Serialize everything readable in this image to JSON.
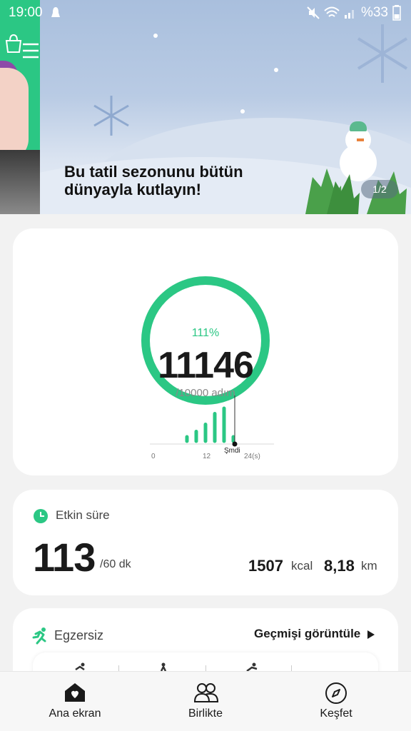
{
  "status_bar": {
    "time": "19:00",
    "battery": "%33"
  },
  "banner": {
    "headline_line1": "Bu tatil sezonunu bütün",
    "headline_line2": "dünyayla kutlayın!",
    "page_indicator": "1/2"
  },
  "steps": {
    "percent": "111%",
    "count": "11146",
    "goal": "/10000 adım",
    "progress_fraction": 1.0,
    "chart": {
      "type": "bar",
      "x_ticks": [
        "0",
        "12",
        "24(s)"
      ],
      "now_label": "Şmdi",
      "bars_relative": [
        0.2,
        0.35,
        0.55,
        0.85,
        1.0,
        0.2
      ]
    }
  },
  "active_time": {
    "title": "Etkin süre",
    "value": "113",
    "goal": "/60 dk",
    "kcal_value": "1507",
    "kcal_unit": "kcal",
    "km_value": "8,18",
    "km_unit": "km"
  },
  "exercise": {
    "title": "Egzersiz",
    "history_link": "Geçmişi görüntüle"
  },
  "nav": {
    "home": "Ana ekran",
    "together": "Birlikte",
    "discover": "Keşfet"
  },
  "colors": {
    "accent_green": "#2bc784",
    "text_dark": "#1a1a1a"
  }
}
